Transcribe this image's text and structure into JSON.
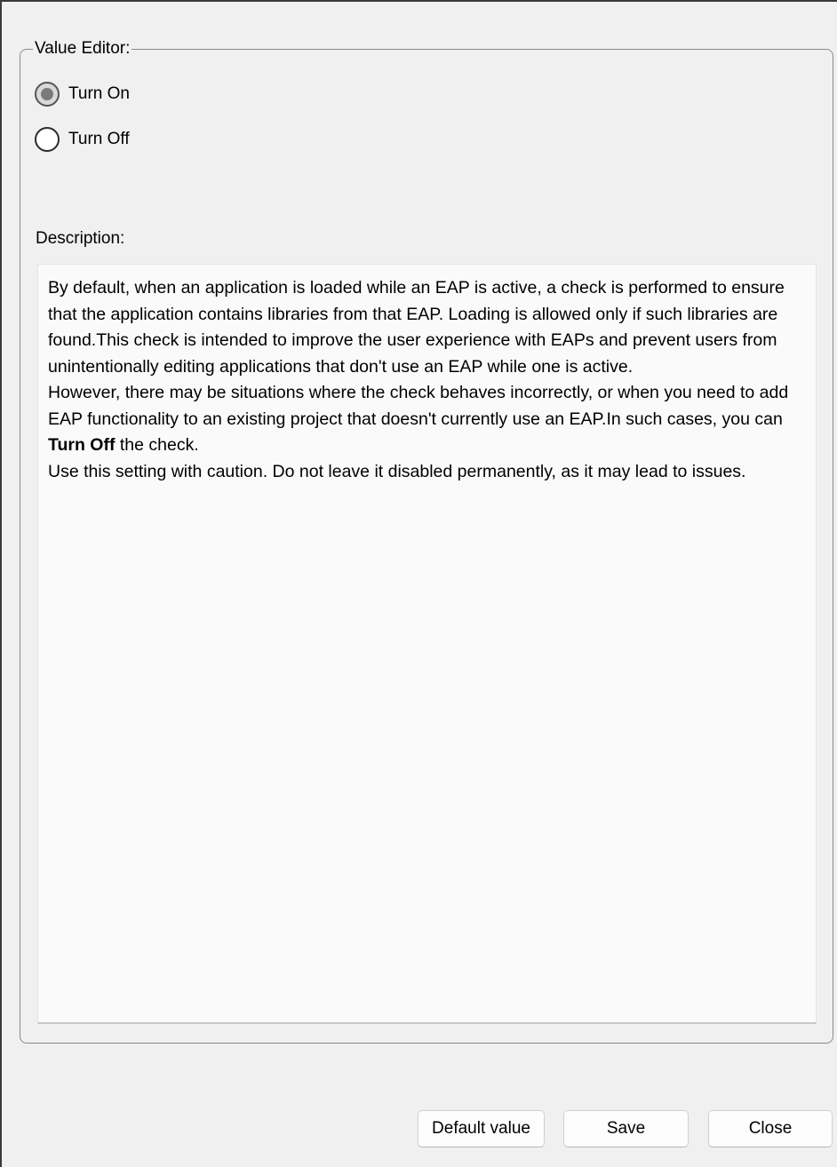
{
  "value_editor": {
    "legend": "Value Editor:",
    "options": [
      {
        "label": "Turn On",
        "checked": true
      },
      {
        "label": "Turn Off",
        "checked": false
      }
    ]
  },
  "description": {
    "label": "Description:",
    "paragraph1": "By default, when an application is loaded while an EAP is active, a check is performed to ensure that the application contains libraries from that EAP. Loading is allowed only if such libraries are found.This check is intended to improve the user experience with EAPs and prevent users from unintentionally editing applications that don't use an EAP while one is active.",
    "paragraph2_pre": "However, there may be situations where the check behaves incorrectly, or when you need to add EAP functionality to an existing project that doesn't currently use an EAP.In such cases, you can ",
    "paragraph2_bold": "Turn Off",
    "paragraph2_post": " the check.",
    "paragraph3": "Use this setting with caution. Do not leave it disabled permanently, as it may lead to issues."
  },
  "buttons": {
    "default_value": "Default value",
    "save": "Save",
    "close": "Close"
  }
}
